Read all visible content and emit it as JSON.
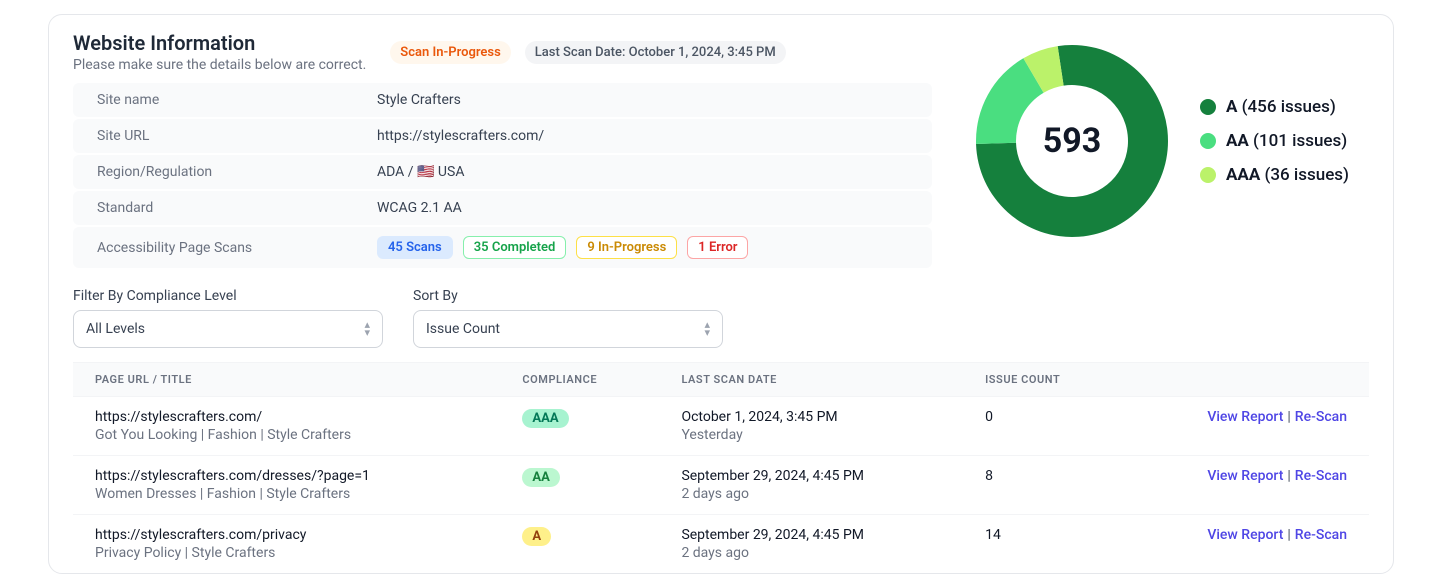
{
  "header": {
    "title": "Website Information",
    "subtitle": "Please make sure the details below are correct.",
    "scan_status": "Scan In-Progress",
    "last_scan": "Last Scan Date: October 1, 2024, 3:45 PM"
  },
  "info": {
    "site_name_label": "Site name",
    "site_name": "Style Crafters",
    "site_url_label": "Site URL",
    "site_url": "https://stylescrafters.com/",
    "region_label": "Region/Regulation",
    "region_value": "ADA / 🇺🇸 USA",
    "standard_label": "Standard",
    "standard_value": "WCAG 2.1 AA",
    "scans_label": "Accessibility Page Scans",
    "scans": {
      "total": "45 Scans",
      "completed": "35 Completed",
      "in_progress": "9 In-Progress",
      "error": "1 Error"
    }
  },
  "chart_data": {
    "type": "pie",
    "title": "",
    "total": 593,
    "series": [
      {
        "name": "A",
        "value": 456,
        "color": "#15803d"
      },
      {
        "name": "AA",
        "value": 101,
        "color": "#4ade80"
      },
      {
        "name": "AAA",
        "value": 36,
        "color": "#bbf26a"
      }
    ],
    "legend": [
      {
        "label": "A",
        "count": "(456 issues)",
        "swatch": "#15803d"
      },
      {
        "label": "AA",
        "count": "(101 issues)",
        "swatch": "#4ade80"
      },
      {
        "label": "AAA",
        "count": "(36 issues)",
        "swatch": "#bbf26a"
      }
    ]
  },
  "filters": {
    "compliance_label": "Filter By Compliance Level",
    "compliance_value": "All Levels",
    "sort_label": "Sort By",
    "sort_value": "Issue Count"
  },
  "table": {
    "headers": {
      "url": "Page URL / Title",
      "compliance": "Compliance",
      "last_scan": "Last Scan Date",
      "issues": "Issue Count"
    },
    "actions": {
      "view": "View Report",
      "rescan": "Re-Scan"
    },
    "rows": [
      {
        "url": "https://stylescrafters.com/",
        "page_title": "Got You Looking | Fashion | Style Crafters",
        "compliance": "AAA",
        "date": "October 1, 2024, 3:45 PM",
        "rel": "Yesterday",
        "issues": "0"
      },
      {
        "url": "https://stylescrafters.com/dresses/?page=1",
        "page_title": "Women Dresses | Fashion | Style Crafters",
        "compliance": "AA",
        "date": "September 29, 2024, 4:45 PM",
        "rel": "2 days ago",
        "issues": "8"
      },
      {
        "url": "https://stylescrafters.com/privacy",
        "page_title": "Privacy Policy | Style Crafters",
        "compliance": "A",
        "date": "September 29, 2024, 4:45 PM",
        "rel": "2 days ago",
        "issues": "14"
      }
    ]
  }
}
